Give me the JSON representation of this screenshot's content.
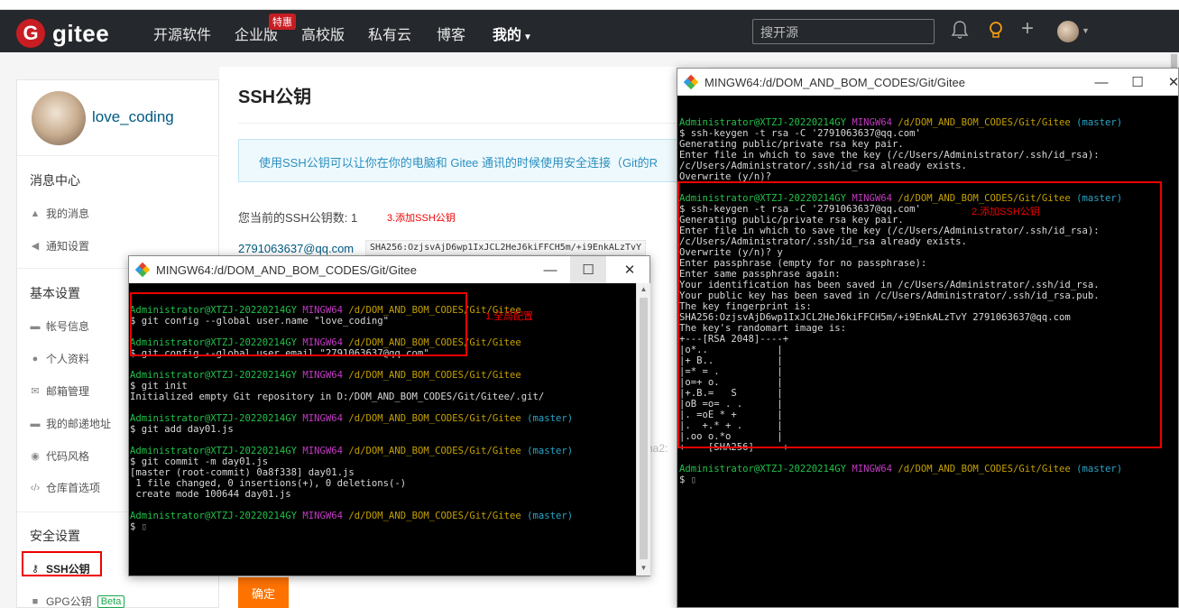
{
  "navbar": {
    "logo": "gitee",
    "items": [
      "开源软件",
      "企业版",
      "高校版",
      "私有云",
      "博客",
      "我的"
    ],
    "hot_badge": "特惠",
    "search_placeholder": "搜开源"
  },
  "sidebar": {
    "username": "love_coding",
    "sections": {
      "messages": "消息中心",
      "basic": "基本设置",
      "security": "安全设置"
    },
    "messages_items": [
      "我的消息",
      "通知设置"
    ],
    "basic_items": [
      "帐号信息",
      "个人资料",
      "邮箱管理",
      "我的邮递地址",
      "代码风格",
      "仓库首选项"
    ],
    "security_items": [
      "SSH公钥",
      "GPG公钥"
    ],
    "beta": "Beta"
  },
  "main": {
    "title": "SSH公钥",
    "info": "使用SSH公钥可以让你在你的电脑和 Gitee 通讯的时候使用安全连接（Git的R",
    "count_label": "您当前的SSH公钥数: 1",
    "annotation": "3.添加SSH公钥",
    "key_email": "2791063637@qq.com",
    "key_hash": "SHA256:OzjsvAjD6wp1IxJCL2HeJ6kiFFCH5m/+i9EnkALzTvY",
    "faint_text": "ha2:",
    "confirm": "确定"
  },
  "terminal_left": {
    "title": "MINGW64:/d/DOM_AND_BOM_CODES/Git/Gitee",
    "user": "Administrator@XTZJ-20220214GY",
    "shell": "MINGW64",
    "path": "/d/DOM_AND_BOM_CODES/Git/Gitee",
    "branch": "(master)",
    "cmd1": "$ git config --global user.name \"love_coding\"",
    "cmd2": "$ git config --global user.email \"2791063637@qq.com\"",
    "cmd3": "$ git init",
    "out3": "Initialized empty Git repository in D:/DOM_AND_BOM_CODES/Git/Gitee/.git/",
    "cmd4": "$ git add day01.js",
    "cmd5": "$ git commit -m day01.js",
    "out5a": "[master (root-commit) 0a8f338] day01.js",
    "out5b": " 1 file changed, 0 insertions(+), 0 deletions(-)",
    "out5c": " create mode 100644 day01.js",
    "prompt": "$ ",
    "annotation": "1.全局配置"
  },
  "terminal_right": {
    "title": "MINGW64:/d/DOM_AND_BOM_CODES/Git/Gitee",
    "user": "Administrator@XTZJ-20220214GY",
    "shell": "MINGW64",
    "path": "/d/DOM_AND_BOM_CODES/Git/Gitee",
    "branch": "(master)",
    "block1": [
      "$ ssh-keygen -t rsa -C '2791063637@qq.com'",
      "Generating public/private rsa key pair.",
      "Enter file in which to save the key (/c/Users/Administrator/.ssh/id_rsa):",
      "/c/Users/Administrator/.ssh/id_rsa already exists.",
      "Overwrite (y/n)?"
    ],
    "block2": [
      "$ ssh-keygen -t rsa -C '2791063637@qq.com'",
      "Generating public/private rsa key pair.",
      "Enter file in which to save the key (/c/Users/Administrator/.ssh/id_rsa):",
      "/c/Users/Administrator/.ssh/id_rsa already exists.",
      "Overwrite (y/n)? y",
      "Enter passphrase (empty for no passphrase):",
      "Enter same passphrase again:",
      "Your identification has been saved in /c/Users/Administrator/.ssh/id_rsa.",
      "Your public key has been saved in /c/Users/Administrator/.ssh/id_rsa.pub.",
      "The key fingerprint is:",
      "SHA256:OzjsvAjD6wp1IxJCL2HeJ6kiFFCH5m/+i9EnkALzTvY 2791063637@qq.com",
      "The key's randomart image is:",
      "+---[RSA 2048]----+",
      "|o*..            |",
      "|+ B..           |",
      "|=* = .          |",
      "|o=+ o.          |",
      "|+.B.=   S       |",
      "|oB =o= . .      |",
      "|. =oE * +       |",
      "|.  +.* + .      |",
      "|.oo o.*o        |",
      "+----[SHA256]-----+"
    ],
    "prompt": "$ ",
    "annotation": "2.添加SSH公钥"
  },
  "colors": {
    "navbar_bg": "#25282c",
    "brand_red": "#c71d23",
    "confirm_orange": "#fe7300",
    "annotation_red": "#ee0000",
    "term_green": "#22c14a",
    "term_magenta": "#c33ac3",
    "term_yellow": "#c4a000",
    "term_cyan": "#2aa4c8"
  }
}
